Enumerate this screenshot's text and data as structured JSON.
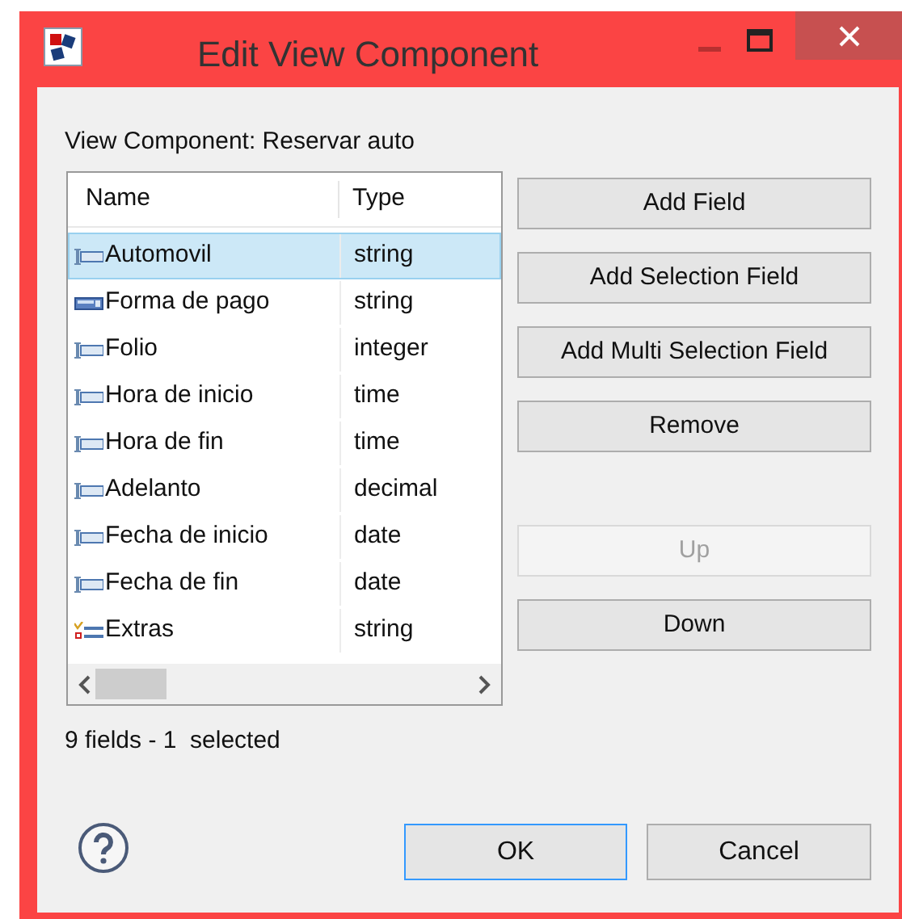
{
  "window": {
    "title": "Edit View Component"
  },
  "label": "View Component: Reservar auto",
  "table": {
    "columns": [
      "Name",
      "Type"
    ],
    "rows": [
      {
        "name": "Automovil",
        "type": "string",
        "kind": "text",
        "selected": true
      },
      {
        "name": "Forma de pago",
        "type": "string",
        "kind": "selection",
        "selected": false
      },
      {
        "name": "Folio",
        "type": "integer",
        "kind": "text",
        "selected": false
      },
      {
        "name": "Hora de inicio",
        "type": "time",
        "kind": "text",
        "selected": false
      },
      {
        "name": "Hora de fin",
        "type": "time",
        "kind": "text",
        "selected": false
      },
      {
        "name": "Adelanto",
        "type": "decimal",
        "kind": "text",
        "selected": false
      },
      {
        "name": "Fecha de inicio",
        "type": "date",
        "kind": "text",
        "selected": false
      },
      {
        "name": "Fecha de fin",
        "type": "date",
        "kind": "text",
        "selected": false
      },
      {
        "name": "Extras",
        "type": "string",
        "kind": "multi",
        "selected": false
      }
    ]
  },
  "side_buttons": [
    {
      "label": "Add Field",
      "disabled": false
    },
    {
      "label": "Add Selection Field",
      "disabled": false
    },
    {
      "label": "Add Multi Selection Field",
      "disabled": false
    },
    {
      "label": "Remove",
      "disabled": false
    },
    {
      "label": "Up",
      "disabled": true
    },
    {
      "label": "Down",
      "disabled": false
    }
  ],
  "status": "9 fields - 1  selected",
  "buttons": [
    {
      "label": "OK",
      "default": true
    },
    {
      "label": "Cancel",
      "default": false
    }
  ]
}
